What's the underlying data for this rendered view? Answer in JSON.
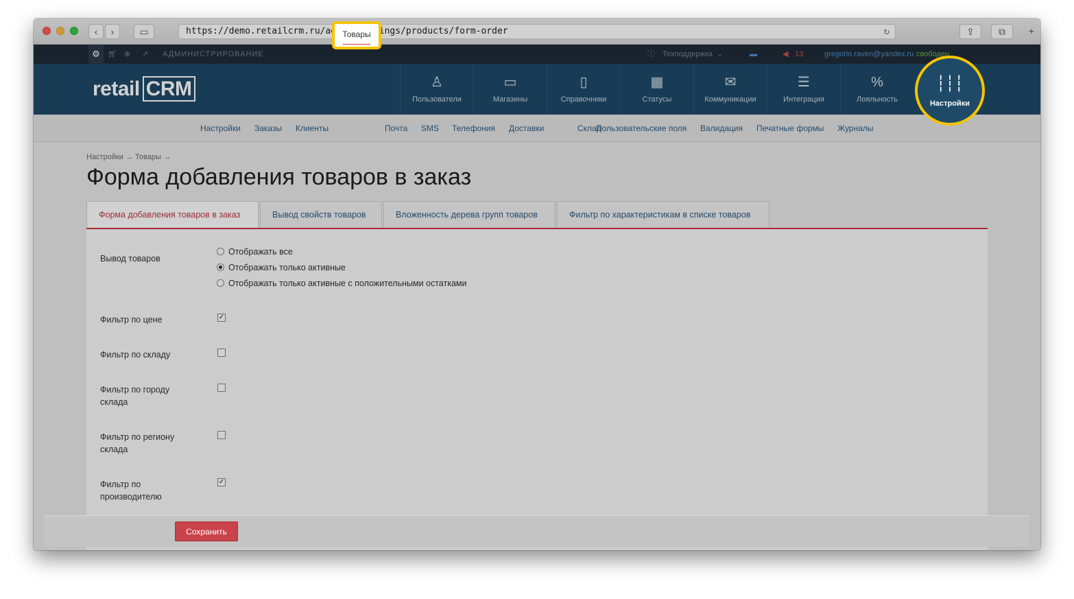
{
  "browser": {
    "url": "https://demo.retailcrm.ru/admin/settings/products/form-order",
    "reload_icon": "reload-icon"
  },
  "admin_strip": {
    "section_label": "АДМИНИСТРИРОВАНИЕ",
    "support_label": "Техподдержка",
    "notifications_count": "13",
    "user_email": "gregorio.raven@yandex.ru",
    "user_status": "свободен"
  },
  "header": {
    "logo_text": "retail",
    "logo_crm": "CRM",
    "nav": [
      {
        "label": "Пользователи",
        "icon": "user-icon"
      },
      {
        "label": "Магазины",
        "icon": "store-icon"
      },
      {
        "label": "Справочники",
        "icon": "document-icon"
      },
      {
        "label": "Статусы",
        "icon": "grid-icon"
      },
      {
        "label": "Коммуникации",
        "icon": "mail-icon"
      },
      {
        "label": "Интеграция",
        "icon": "lines-icon"
      },
      {
        "label": "Лояльность",
        "icon": "percent-icon"
      },
      {
        "label": "Настройки",
        "icon": "sliders-icon"
      }
    ]
  },
  "subnav": {
    "items": [
      "Настройки",
      "Заказы",
      "Клиенты",
      "Товары",
      "Почта",
      "SMS",
      "Телефония",
      "Доставки",
      "Склад",
      "Пользовательские поля",
      "Валидация",
      "Печатные формы",
      "Журналы"
    ],
    "active": "Товары"
  },
  "page": {
    "breadcrumb": "Настройки → Товары →",
    "title": "Форма добавления товаров в заказ",
    "tabs": [
      "Форма добавления товаров в заказ",
      "Вывод свойств товаров",
      "Вложенность дерева групп товаров",
      "Фильтр по характеристикам в списке товаров"
    ]
  },
  "form": {
    "output_label": "Вывод товаров",
    "output_options": [
      "Отображать все",
      "Отображать только активные",
      "Отображать только активные с положительными остатками"
    ],
    "output_selected": "Отображать только активные",
    "filters": [
      {
        "label": "Фильтр по цене",
        "checked": true
      },
      {
        "label": "Фильтр по складу",
        "checked": false
      },
      {
        "label": "Фильтр по городу склада",
        "checked": false
      },
      {
        "label": "Фильтр по региону склада",
        "checked": false
      },
      {
        "label": "Фильтр по производителю",
        "checked": true
      }
    ]
  },
  "footer": {
    "save_label": "Сохранить"
  },
  "colors": {
    "header_bg": "#1e4a68",
    "highlight": "#f5c400",
    "accent_red": "#c9434a"
  }
}
